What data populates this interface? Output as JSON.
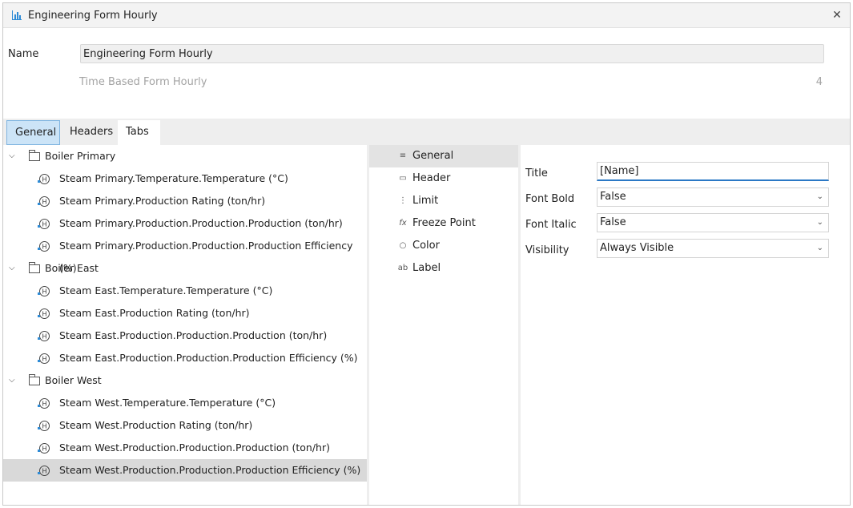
{
  "window": {
    "title": "Engineering Form Hourly",
    "close": "✕"
  },
  "form": {
    "name_label": "Name",
    "name_value": "Engineering Form Hourly",
    "description": "Time Based Form Hourly",
    "count": "4"
  },
  "tabs": [
    {
      "label": "General"
    },
    {
      "label": "Headers"
    },
    {
      "label": "Tabs"
    }
  ],
  "tree": {
    "groups": [
      {
        "label": "Boiler Primary",
        "items": [
          "Steam Primary.Temperature.Temperature (°C)",
          "Steam Primary.Production Rating (ton/hr)",
          "Steam Primary.Production.Production.Production (ton/hr)",
          "Steam Primary.Production.Production.Production Efficiency (%)"
        ]
      },
      {
        "label": "Boiler East",
        "items": [
          "Steam East.Temperature.Temperature (°C)",
          "Steam East.Production Rating (ton/hr)",
          "Steam East.Production.Production.Production (ton/hr)",
          "Steam East.Production.Production.Production Efficiency (%)"
        ]
      },
      {
        "label": "Boiler West",
        "items": [
          "Steam West.Temperature.Temperature (°C)",
          "Steam West.Production Rating (ton/hr)",
          "Steam West.Production.Production.Production (ton/hr)",
          "Steam West.Production.Production.Production Efficiency (%)"
        ]
      }
    ],
    "selected_item": "Steam West.Production.Production.Production Efficiency (%)"
  },
  "categories": [
    {
      "label": "General",
      "icon": "list-icon"
    },
    {
      "label": "Header",
      "icon": "header-icon"
    },
    {
      "label": "Limit",
      "icon": "limit-icon"
    },
    {
      "label": "Freeze Point",
      "icon": "function-icon"
    },
    {
      "label": "Color",
      "icon": "color-icon"
    },
    {
      "label": "Label",
      "icon": "label-icon"
    }
  ],
  "properties": {
    "title_label": "Title",
    "title_value": "[Name]",
    "font_bold_label": "Font Bold",
    "font_bold_value": "False",
    "font_italic_label": "Font Italic",
    "font_italic_value": "False",
    "visibility_label": "Visibility",
    "visibility_value": "Always Visible"
  },
  "colors": {
    "accent": "#2b78c5",
    "selected_tab_bg": "#cce4f7",
    "selected_row_bg": "#d9d9d9",
    "icon_blue": "#2e8bd6"
  }
}
